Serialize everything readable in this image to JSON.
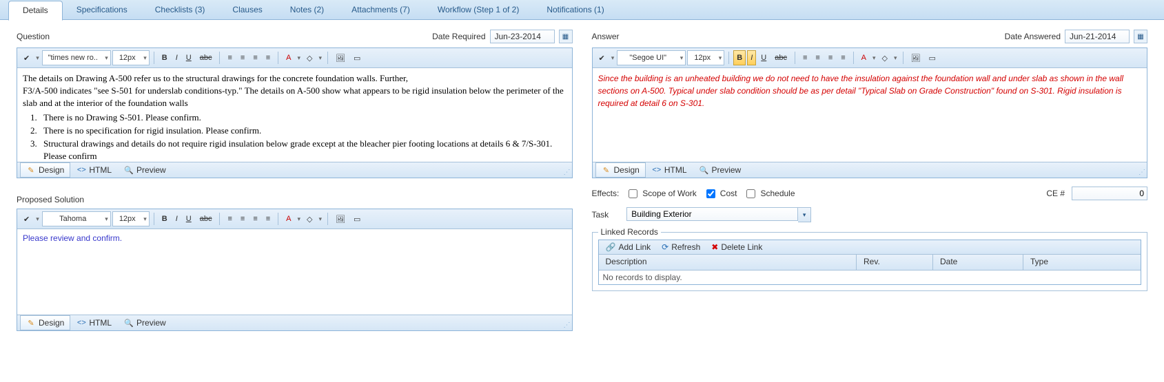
{
  "tabs": [
    "Details",
    "Specifications",
    "Checklists (3)",
    "Clauses",
    "Notes (2)",
    "Attachments (7)",
    "Workflow (Step 1 of 2)",
    "Notifications (1)"
  ],
  "question": {
    "label": "Question",
    "date_label": "Date Required",
    "date_value": "Jun-23-2014",
    "toolbar": {
      "font": "\"times new ro..",
      "size": "12px"
    },
    "body_intro": "The details on Drawing A-500 refer us to the structural drawings for the concrete foundation walls. Further,",
    "body_line2": "F3/A-500 indicates \"see S-501 for underslab conditions-typ.\" The details on A-500 show what appears to be rigid insulation below the perimeter of the slab and at the interior of the foundation walls",
    "body_list": [
      "There is no Drawing S-501. Please confirm.",
      "There is no specification for rigid insulation. Please confirm.",
      "Structural drawings and details do not require rigid insulation below grade except at the bleacher pier footing locations at details 6 & 7/S-301. Please confirm"
    ]
  },
  "answer": {
    "label": "Answer",
    "date_label": "Date Answered",
    "date_value": "Jun-21-2014",
    "toolbar": {
      "font": "\"Segoe UI\"",
      "size": "12px"
    },
    "body": "Since the building is an unheated building we do not need to have the insulation against the foundation wall and under slab as shown in the wall sections on A-500. Typical under slab condition should be as per detail \"Typical Slab on Grade Construction\" found on S-301. Rigid insulation is required at detail 6 on S-301."
  },
  "proposed": {
    "label": "Proposed Solution",
    "toolbar": {
      "font": "Tahoma",
      "size": "12px"
    },
    "body": "Please review and confirm."
  },
  "modes": {
    "design": "Design",
    "html": "HTML",
    "preview": "Preview"
  },
  "effects": {
    "label": "Effects:",
    "scope": "Scope of Work",
    "cost": "Cost",
    "schedule": "Schedule",
    "cost_checked": true,
    "ce_label": "CE #",
    "ce_value": "0"
  },
  "task": {
    "label": "Task",
    "value": "Building Exterior"
  },
  "linked": {
    "title": "Linked Records",
    "add": "Add Link",
    "refresh": "Refresh",
    "del": "Delete Link",
    "cols": {
      "desc": "Description",
      "rev": "Rev.",
      "date": "Date",
      "type": "Type"
    },
    "empty": "No records to display."
  }
}
